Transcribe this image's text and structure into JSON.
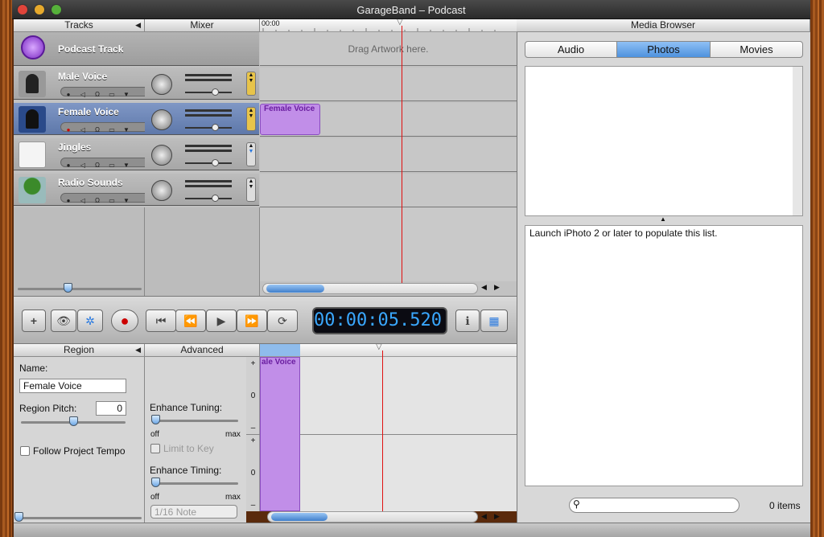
{
  "window": {
    "title": "GarageBand – Podcast"
  },
  "tracks_header": {
    "tracks": "Tracks",
    "mixer": "Mixer",
    "ruler_start": "00:00"
  },
  "podcast_track": {
    "name": "Podcast Track",
    "drop_hint": "Drag Artwork here."
  },
  "tracks": [
    {
      "name": "Male Voice",
      "selected": false
    },
    {
      "name": "Female Voice",
      "selected": true
    },
    {
      "name": "Jingles",
      "selected": false
    },
    {
      "name": "Radio Sounds",
      "selected": false
    }
  ],
  "timeline_region": {
    "label": "Female Voice",
    "color": "#c18ee8"
  },
  "transport": {
    "time": "00:00:05.520",
    "lcd_color": "#3aa8ff"
  },
  "region_panel": {
    "header": "Region",
    "name_label": "Name:",
    "name_value": "Female Voice",
    "pitch_label": "Region Pitch:",
    "pitch_value": "0",
    "pitch_level": 0.5,
    "follow_tempo": "Follow Project Tempo"
  },
  "advanced_panel": {
    "header": "Advanced",
    "tuning_label": "Enhance Tuning:",
    "tuning_level": 0,
    "timing_level": 0,
    "off": "off",
    "max": "max",
    "limit_key": "Limit to Key",
    "timing_label": "Enhance Timing:",
    "note_value": "1/16 Note"
  },
  "editor": {
    "region_label": "ale Voice",
    "plus": "+",
    "zero": "0",
    "minus": "–"
  },
  "media_browser": {
    "title": "Media Browser",
    "tabs": [
      {
        "label": "Audio",
        "active": false
      },
      {
        "label": "Photos",
        "active": true
      },
      {
        "label": "Movies",
        "active": false
      }
    ],
    "message": "Launch iPhoto 2 or later to populate this list.",
    "search_placeholder": "",
    "count": "0 items"
  }
}
